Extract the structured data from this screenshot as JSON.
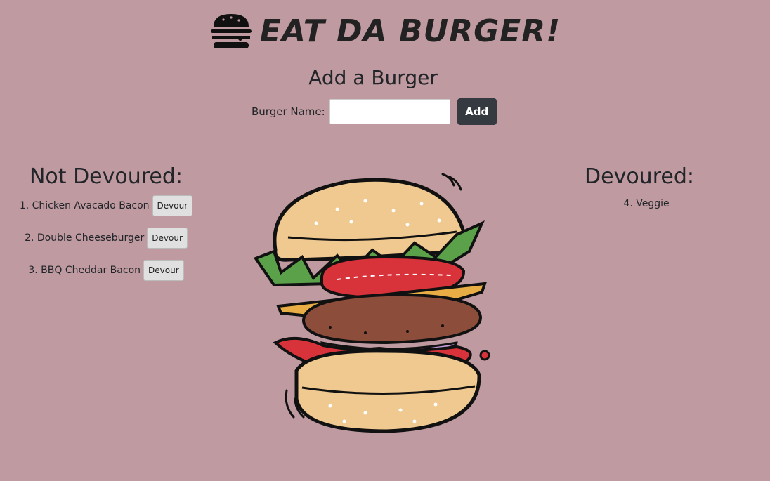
{
  "header": {
    "title": "EAT DA BURGER!",
    "icon": "burger-icon"
  },
  "add_burger": {
    "title": "Add a Burger",
    "name_label": "Burger Name:",
    "name_value": "",
    "name_placeholder": "",
    "add_label": "Add"
  },
  "not_devoured": {
    "title": "Not Devoured:",
    "items": [
      {
        "text": "1. Chicken Avacado Bacon",
        "button": "Devour"
      },
      {
        "text": "2. Double Cheeseburger",
        "button": "Devour"
      },
      {
        "text": "3. BBQ Cheddar Bacon",
        "button": "Devour"
      }
    ]
  },
  "devoured": {
    "title": "Devoured:",
    "items": [
      {
        "text": "4. Veggie"
      }
    ]
  },
  "colors": {
    "background": "#bf9aa0",
    "add_button": "#343a40",
    "devour_button": "#e0e0e0"
  }
}
